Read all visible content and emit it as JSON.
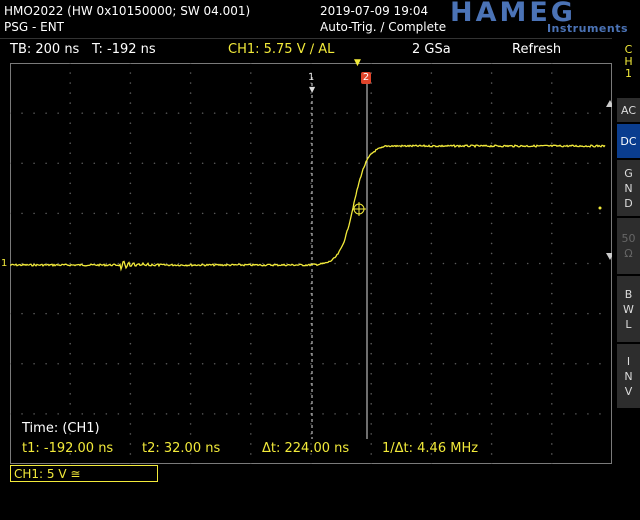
{
  "header": {
    "device": "HMO2022 (HW 0x10150000; SW 04.001)",
    "mode": "PSG - ENT",
    "datetime": "2019-07-09 19:04",
    "trigger_status": "Auto-Trig. / Complete",
    "logo_main": "HAMEG",
    "logo_sub": "Instruments"
  },
  "status": {
    "timebase": "TB: 200 ns",
    "trigger_time": "T: -192 ns",
    "channel": "CH1: 5.75 V ∕ AL",
    "sample_rate": "2 GSa",
    "acq_mode": "Refresh"
  },
  "side_panel": {
    "channel_label": [
      "C",
      "H",
      "1"
    ],
    "buttons": [
      {
        "id": "ac",
        "label": [
          "AC"
        ]
      },
      {
        "id": "dc",
        "label": [
          "DC"
        ]
      },
      {
        "id": "gnd",
        "label": [
          "G",
          "N",
          "D"
        ]
      },
      {
        "id": "50",
        "label": [
          "50",
          "Ω"
        ]
      },
      {
        "id": "bwl",
        "label": [
          "B",
          "W",
          "L"
        ]
      },
      {
        "id": "inv",
        "label": [
          "I",
          "N",
          "V"
        ]
      }
    ]
  },
  "markers": {
    "cursor1": "1",
    "cursor2": "2",
    "channel_marker": "1"
  },
  "measurement": {
    "title": "Time: (CH1)",
    "t1": "t1: -192.00 ns",
    "t2": "t2: 32.00 ns",
    "dt": "Δt: 224.00 ns",
    "inv_dt": "1/Δt: 4.46 MHz"
  },
  "channel_box": "CH1: 5 V ≅",
  "colors": {
    "trace": "#f2ea3a",
    "accent": "#0a3d8f",
    "logo": "#4b73b6",
    "cursor2_marker": "#e0442a"
  }
}
